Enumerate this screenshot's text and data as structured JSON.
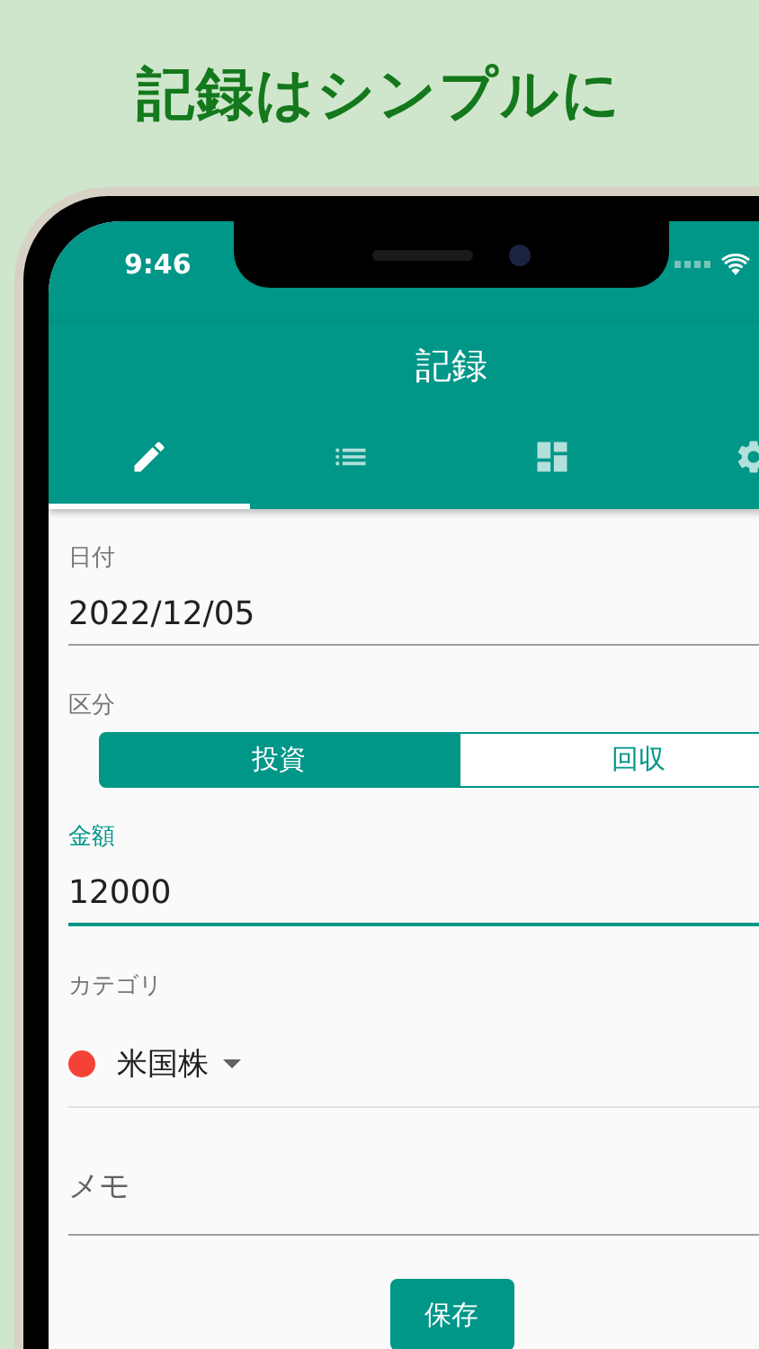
{
  "headline": "記録はシンプルに",
  "status_bar": {
    "time": "9:46"
  },
  "app_bar": {
    "title": "記録"
  },
  "tabs": [
    {
      "kind": "pencil",
      "selected": true
    },
    {
      "kind": "list",
      "selected": false
    },
    {
      "kind": "dashboard",
      "selected": false
    },
    {
      "kind": "gear",
      "selected": false
    }
  ],
  "date_field": {
    "label": "日付",
    "value": "2022/12/05",
    "focused": false
  },
  "type_field": {
    "label": "区分",
    "segments": [
      {
        "label": "投資",
        "selected": true
      },
      {
        "label": "回収",
        "selected": false
      }
    ]
  },
  "amount_field": {
    "label": "金額",
    "value": "12000",
    "focused": true
  },
  "category_field": {
    "label": "カテゴリ",
    "value": "米国株",
    "color": "#f44336"
  },
  "memo_field": {
    "placeholder": "メモ"
  },
  "save_button": "保存"
}
